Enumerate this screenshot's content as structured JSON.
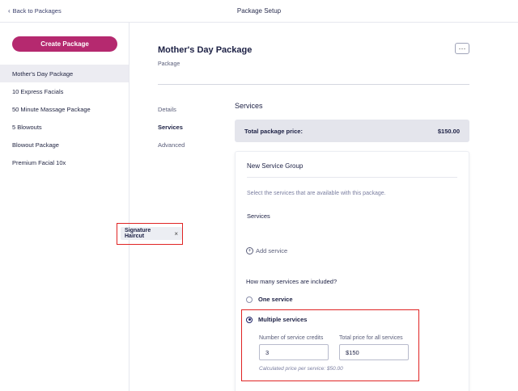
{
  "header": {
    "back_label": "Back to Packages",
    "title": "Package Setup"
  },
  "sidebar": {
    "create_label": "Create Package",
    "brand_color": "#b5296f",
    "packages": [
      {
        "label": "Mother's Day Package",
        "active": true
      },
      {
        "label": "10 Express Facials",
        "active": false
      },
      {
        "label": "50 Minute Massage Package",
        "active": false
      },
      {
        "label": "5 Blowouts",
        "active": false
      },
      {
        "label": "Blowout Package",
        "active": false
      },
      {
        "label": "Premium Facial 10x",
        "active": false
      }
    ]
  },
  "package": {
    "title": "Mother's Day Package",
    "subtitle": "Package",
    "more_label": "···"
  },
  "tabs": [
    {
      "label": "Details",
      "active": false
    },
    {
      "label": "Services",
      "active": true
    },
    {
      "label": "Advanced",
      "active": false
    }
  ],
  "services_section": {
    "title": "Services",
    "total_label": "Total package price:",
    "total_value": "$150.00"
  },
  "group": {
    "title": "New Service Group",
    "hint": "Select the services that are available with this package.",
    "services_label": "Services",
    "chip_label": "Signature Haircut",
    "chip_remove": "×",
    "add_service_label": "Add service",
    "how_many_label": "How many services are included?",
    "option_one": "One service",
    "option_multiple": "Multiple services",
    "selected_option": "multiple",
    "credits_label": "Number of service credits",
    "credits_value": "3",
    "price_label": "Total price for all services",
    "price_value": "$150",
    "calc_note": "Calculated price per service: $50.00"
  },
  "highlight_color": "#e02424"
}
